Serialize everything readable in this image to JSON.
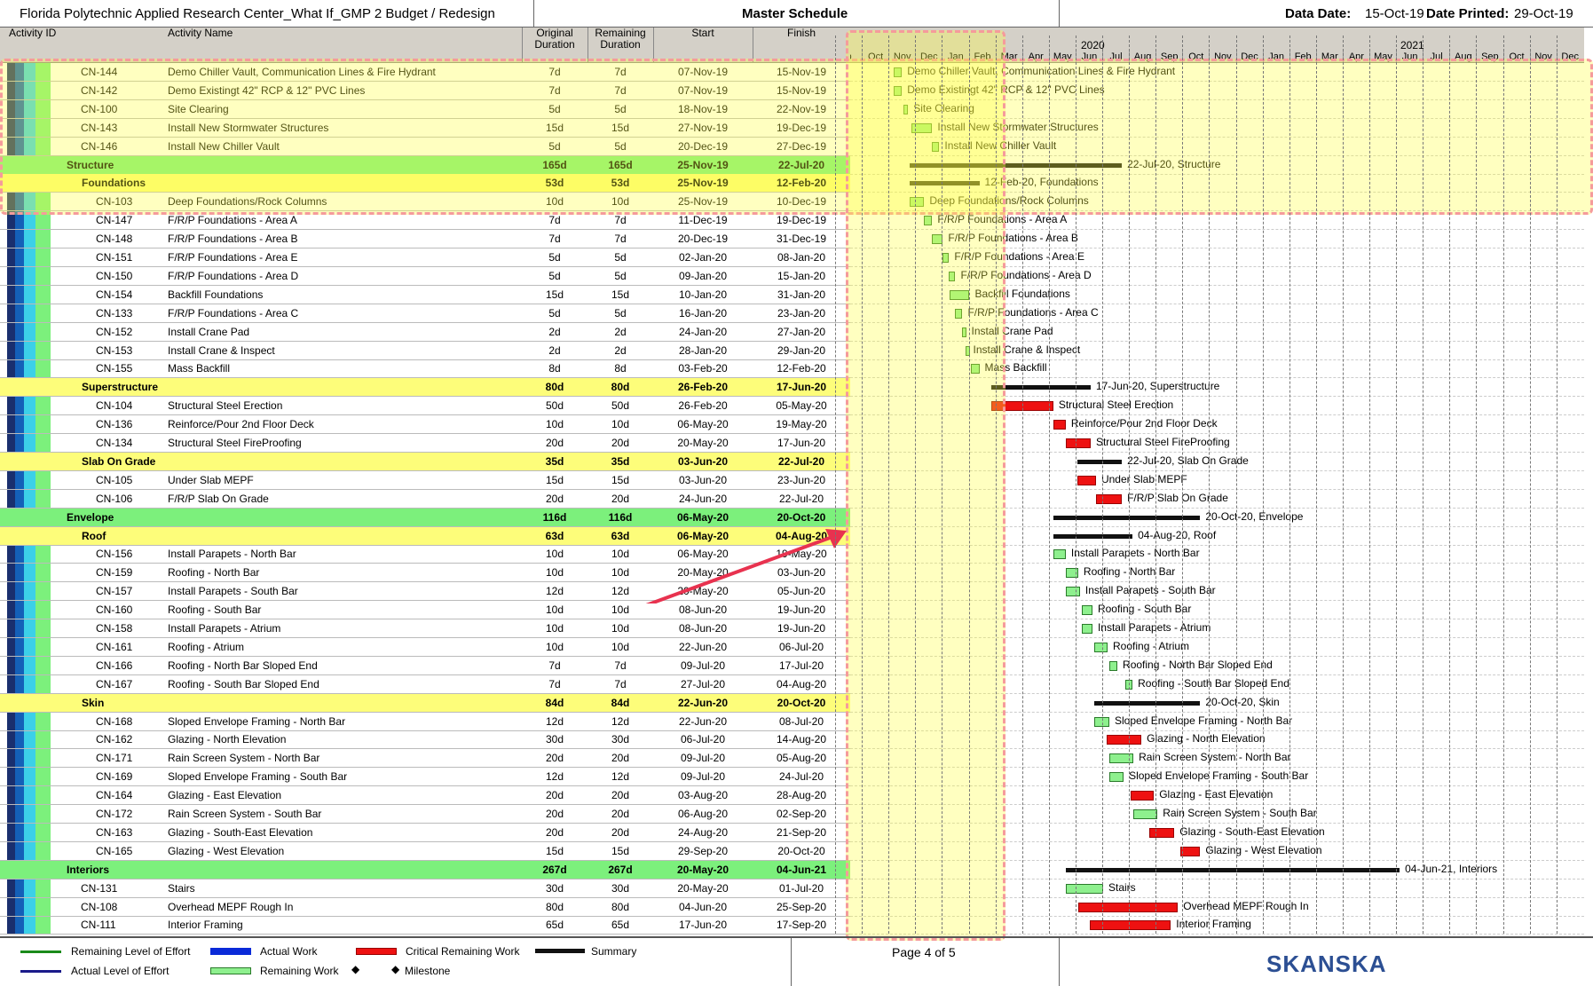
{
  "header": {
    "project": "Florida Polytechnic Applied Research Center_What If_GMP 2 Budget / Redesign",
    "title": "Master Schedule",
    "data_date_label": "Data Date:",
    "data_date": "15-Oct-19",
    "printed_label": "Date Printed:",
    "printed": "29-Oct-19"
  },
  "columns": {
    "activity_id": "Activity ID",
    "activity_name": "Activity Name",
    "orig1": "Original",
    "orig2": "Duration",
    "rem1": "Remaining",
    "rem2": "Duration",
    "start": "Start",
    "finish": "Finish"
  },
  "timeline": {
    "years": [
      "2020",
      "2021"
    ],
    "months": [
      "p",
      "Oct",
      "Nov",
      "Dec",
      "Jan",
      "Feb",
      "Mar",
      "Apr",
      "May",
      "Jun",
      "Jul",
      "Aug",
      "Sep",
      "Oct",
      "Nov",
      "Dec",
      "Jan",
      "Feb",
      "Mar",
      "Apr",
      "May",
      "Jun",
      "Jul",
      "Aug",
      "Sep",
      "Oct",
      "Nov",
      "Dec"
    ]
  },
  "rows": [
    {
      "kind": "act",
      "id": "CN-144",
      "name": "Demo Chiller Vault, Communication Lines & Fire Hydrant",
      "od": "7d",
      "rd": "7d",
      "start": "07-Nov-19",
      "finish": "15-Nov-19",
      "bar": "g",
      "lvl": 2
    },
    {
      "kind": "act",
      "id": "CN-142",
      "name": "Demo Existingt 42\" RCP & 12\" PVC Lines",
      "od": "7d",
      "rd": "7d",
      "start": "07-Nov-19",
      "finish": "15-Nov-19",
      "bar": "g",
      "lvl": 2
    },
    {
      "kind": "act",
      "id": "CN-100",
      "name": "Site Clearing",
      "od": "5d",
      "rd": "5d",
      "start": "18-Nov-19",
      "finish": "22-Nov-19",
      "bar": "g",
      "lvl": 2
    },
    {
      "kind": "act",
      "id": "CN-143",
      "name": "Install New Stormwater Structures",
      "od": "15d",
      "rd": "15d",
      "start": "27-Nov-19",
      "finish": "19-Dec-19",
      "bar": "g",
      "lvl": 2
    },
    {
      "kind": "act",
      "id": "CN-146",
      "name": "Install New Chiller Vault",
      "od": "5d",
      "rd": "5d",
      "start": "20-Dec-19",
      "finish": "27-Dec-19",
      "bar": "g",
      "lvl": 2
    },
    {
      "kind": "g1",
      "name": "Structure",
      "od": "165d",
      "rd": "165d",
      "start": "25-Nov-19",
      "finish": "22-Jul-20",
      "label": "22-Jul-20, Structure"
    },
    {
      "kind": "g2",
      "name": "Foundations",
      "od": "53d",
      "rd": "53d",
      "start": "25-Nov-19",
      "finish": "12-Feb-20",
      "label": "12-Feb-20, Foundations"
    },
    {
      "kind": "act",
      "id": "CN-103",
      "name": "Deep Foundations/Rock Columns",
      "od": "10d",
      "rd": "10d",
      "start": "25-Nov-19",
      "finish": "10-Dec-19",
      "bar": "g",
      "lvl": 3
    },
    {
      "kind": "act",
      "id": "CN-147",
      "name": "F/R/P Foundations - Area A",
      "od": "7d",
      "rd": "7d",
      "start": "11-Dec-19",
      "finish": "19-Dec-19",
      "bar": "g",
      "lvl": 3
    },
    {
      "kind": "act",
      "id": "CN-148",
      "name": "F/R/P Foundations - Area B",
      "od": "7d",
      "rd": "7d",
      "start": "20-Dec-19",
      "finish": "31-Dec-19",
      "bar": "g",
      "lvl": 3
    },
    {
      "kind": "act",
      "id": "CN-151",
      "name": "F/R/P Foundations - Area E",
      "od": "5d",
      "rd": "5d",
      "start": "02-Jan-20",
      "finish": "08-Jan-20",
      "bar": "g",
      "lvl": 3
    },
    {
      "kind": "act",
      "id": "CN-150",
      "name": "F/R/P Foundations - Area D",
      "od": "5d",
      "rd": "5d",
      "start": "09-Jan-20",
      "finish": "15-Jan-20",
      "bar": "g",
      "lvl": 3
    },
    {
      "kind": "act",
      "id": "CN-154",
      "name": "Backfill Foundations",
      "od": "15d",
      "rd": "15d",
      "start": "10-Jan-20",
      "finish": "31-Jan-20",
      "bar": "g",
      "lvl": 3
    },
    {
      "kind": "act",
      "id": "CN-133",
      "name": "F/R/P Foundations - Area C",
      "od": "5d",
      "rd": "5d",
      "start": "16-Jan-20",
      "finish": "23-Jan-20",
      "bar": "g",
      "lvl": 3
    },
    {
      "kind": "act",
      "id": "CN-152",
      "name": "Install Crane Pad",
      "od": "2d",
      "rd": "2d",
      "start": "24-Jan-20",
      "finish": "27-Jan-20",
      "bar": "g",
      "lvl": 3
    },
    {
      "kind": "act",
      "id": "CN-153",
      "name": "Install Crane & Inspect",
      "od": "2d",
      "rd": "2d",
      "start": "28-Jan-20",
      "finish": "29-Jan-20",
      "bar": "g",
      "lvl": 3
    },
    {
      "kind": "act",
      "id": "CN-155",
      "name": "Mass Backfill",
      "od": "8d",
      "rd": "8d",
      "start": "03-Feb-20",
      "finish": "12-Feb-20",
      "bar": "g",
      "lvl": 3
    },
    {
      "kind": "g2",
      "name": "Superstructure",
      "od": "80d",
      "rd": "80d",
      "start": "26-Feb-20",
      "finish": "17-Jun-20",
      "label": "17-Jun-20, Superstructure"
    },
    {
      "kind": "act",
      "id": "CN-104",
      "name": "Structural Steel Erection",
      "od": "50d",
      "rd": "50d",
      "start": "26-Feb-20",
      "finish": "05-May-20",
      "bar": "r",
      "lvl": 3
    },
    {
      "kind": "act",
      "id": "CN-136",
      "name": "Reinforce/Pour 2nd Floor Deck",
      "od": "10d",
      "rd": "10d",
      "start": "06-May-20",
      "finish": "19-May-20",
      "bar": "r",
      "lvl": 3
    },
    {
      "kind": "act",
      "id": "CN-134",
      "name": "Structural Steel FireProofing",
      "od": "20d",
      "rd": "20d",
      "start": "20-May-20",
      "finish": "17-Jun-20",
      "bar": "r",
      "lvl": 3
    },
    {
      "kind": "g2",
      "name": "Slab On Grade",
      "od": "35d",
      "rd": "35d",
      "start": "03-Jun-20",
      "finish": "22-Jul-20",
      "label": "22-Jul-20, Slab On Grade"
    },
    {
      "kind": "act",
      "id": "CN-105",
      "name": "Under Slab MEPF",
      "od": "15d",
      "rd": "15d",
      "start": "03-Jun-20",
      "finish": "23-Jun-20",
      "bar": "r",
      "lvl": 3
    },
    {
      "kind": "act",
      "id": "CN-106",
      "name": "F/R/P Slab On Grade",
      "od": "20d",
      "rd": "20d",
      "start": "24-Jun-20",
      "finish": "22-Jul-20",
      "bar": "r",
      "lvl": 3
    },
    {
      "kind": "g1",
      "name": "Envelope",
      "od": "116d",
      "rd": "116d",
      "start": "06-May-20",
      "finish": "20-Oct-20",
      "label": "20-Oct-20, Envelope"
    },
    {
      "kind": "g2",
      "name": "Roof",
      "od": "63d",
      "rd": "63d",
      "start": "06-May-20",
      "finish": "04-Aug-20",
      "label": "04-Aug-20, Roof"
    },
    {
      "kind": "act",
      "id": "CN-156",
      "name": "Install Parapets - North Bar",
      "od": "10d",
      "rd": "10d",
      "start": "06-May-20",
      "finish": "19-May-20",
      "bar": "g",
      "lvl": 3
    },
    {
      "kind": "act",
      "id": "CN-159",
      "name": "Roofing - North Bar",
      "od": "10d",
      "rd": "10d",
      "start": "20-May-20",
      "finish": "03-Jun-20",
      "bar": "g",
      "lvl": 3
    },
    {
      "kind": "act",
      "id": "CN-157",
      "name": "Install Parapets - South Bar",
      "od": "12d",
      "rd": "12d",
      "start": "20-May-20",
      "finish": "05-Jun-20",
      "bar": "g",
      "lvl": 3
    },
    {
      "kind": "act",
      "id": "CN-160",
      "name": "Roofing - South Bar",
      "od": "10d",
      "rd": "10d",
      "start": "08-Jun-20",
      "finish": "19-Jun-20",
      "bar": "g",
      "lvl": 3
    },
    {
      "kind": "act",
      "id": "CN-158",
      "name": "Install Parapets - Atrium",
      "od": "10d",
      "rd": "10d",
      "start": "08-Jun-20",
      "finish": "19-Jun-20",
      "bar": "g",
      "lvl": 3
    },
    {
      "kind": "act",
      "id": "CN-161",
      "name": "Roofing - Atrium",
      "od": "10d",
      "rd": "10d",
      "start": "22-Jun-20",
      "finish": "06-Jul-20",
      "bar": "g",
      "lvl": 3
    },
    {
      "kind": "act",
      "id": "CN-166",
      "name": "Roofing - North Bar Sloped End",
      "od": "7d",
      "rd": "7d",
      "start": "09-Jul-20",
      "finish": "17-Jul-20",
      "bar": "g",
      "lvl": 3
    },
    {
      "kind": "act",
      "id": "CN-167",
      "name": "Roofing - South Bar Sloped End",
      "od": "7d",
      "rd": "7d",
      "start": "27-Jul-20",
      "finish": "04-Aug-20",
      "bar": "g",
      "lvl": 3
    },
    {
      "kind": "g2",
      "name": "Skin",
      "od": "84d",
      "rd": "84d",
      "start": "22-Jun-20",
      "finish": "20-Oct-20",
      "label": "20-Oct-20, Skin"
    },
    {
      "kind": "act",
      "id": "CN-168",
      "name": "Sloped Envelope Framing - North Bar",
      "od": "12d",
      "rd": "12d",
      "start": "22-Jun-20",
      "finish": "08-Jul-20",
      "bar": "g",
      "lvl": 3
    },
    {
      "kind": "act",
      "id": "CN-162",
      "name": "Glazing - North Elevation",
      "od": "30d",
      "rd": "30d",
      "start": "06-Jul-20",
      "finish": "14-Aug-20",
      "bar": "r",
      "lvl": 3
    },
    {
      "kind": "act",
      "id": "CN-171",
      "name": "Rain Screen System - North Bar",
      "od": "20d",
      "rd": "20d",
      "start": "09-Jul-20",
      "finish": "05-Aug-20",
      "bar": "g",
      "lvl": 3
    },
    {
      "kind": "act",
      "id": "CN-169",
      "name": "Sloped Envelope Framing - South Bar",
      "od": "12d",
      "rd": "12d",
      "start": "09-Jul-20",
      "finish": "24-Jul-20",
      "bar": "g",
      "lvl": 3
    },
    {
      "kind": "act",
      "id": "CN-164",
      "name": "Glazing - East Elevation",
      "od": "20d",
      "rd": "20d",
      "start": "03-Aug-20",
      "finish": "28-Aug-20",
      "bar": "r",
      "lvl": 3
    },
    {
      "kind": "act",
      "id": "CN-172",
      "name": "Rain Screen System - South Bar",
      "od": "20d",
      "rd": "20d",
      "start": "06-Aug-20",
      "finish": "02-Sep-20",
      "bar": "g",
      "lvl": 3
    },
    {
      "kind": "act",
      "id": "CN-163",
      "name": "Glazing - South-East Elevation",
      "od": "20d",
      "rd": "20d",
      "start": "24-Aug-20",
      "finish": "21-Sep-20",
      "bar": "r",
      "lvl": 3
    },
    {
      "kind": "act",
      "id": "CN-165",
      "name": "Glazing - West Elevation",
      "od": "15d",
      "rd": "15d",
      "start": "29-Sep-20",
      "finish": "20-Oct-20",
      "bar": "r",
      "lvl": 3
    },
    {
      "kind": "g1",
      "name": "Interiors",
      "od": "267d",
      "rd": "267d",
      "start": "20-May-20",
      "finish": "04-Jun-21",
      "label": "04-Jun-21, Interiors"
    },
    {
      "kind": "act",
      "id": "CN-131",
      "name": "Stairs",
      "od": "30d",
      "rd": "30d",
      "start": "20-May-20",
      "finish": "01-Jul-20",
      "bar": "g",
      "lvl": 2
    },
    {
      "kind": "act",
      "id": "CN-108",
      "name": "Overhead MEPF Rough In",
      "od": "80d",
      "rd": "80d",
      "start": "04-Jun-20",
      "finish": "25-Sep-20",
      "bar": "r",
      "lvl": 2
    },
    {
      "kind": "act",
      "id": "CN-111",
      "name": "Interior Framing",
      "od": "65d",
      "rd": "65d",
      "start": "17-Jun-20",
      "finish": "17-Sep-20",
      "bar": "r",
      "lvl": 2
    }
  ],
  "legend": {
    "rloe": "Remaining Level of Effort",
    "aloe": "Actual Level of Effort",
    "aw": "Actual Work",
    "rw": "Remaining Work",
    "crw": "Critical Remaining Work",
    "sum": "Summary",
    "ms": "Milestone"
  },
  "footer": {
    "page": "Page 4 of 5",
    "logo": "SKANSKA"
  },
  "colors": {
    "group1": "#7cf07c",
    "group2": "#fdfd7a",
    "remaining": "#8ef08e",
    "critical": "#ee1111",
    "summary": "#111111"
  }
}
